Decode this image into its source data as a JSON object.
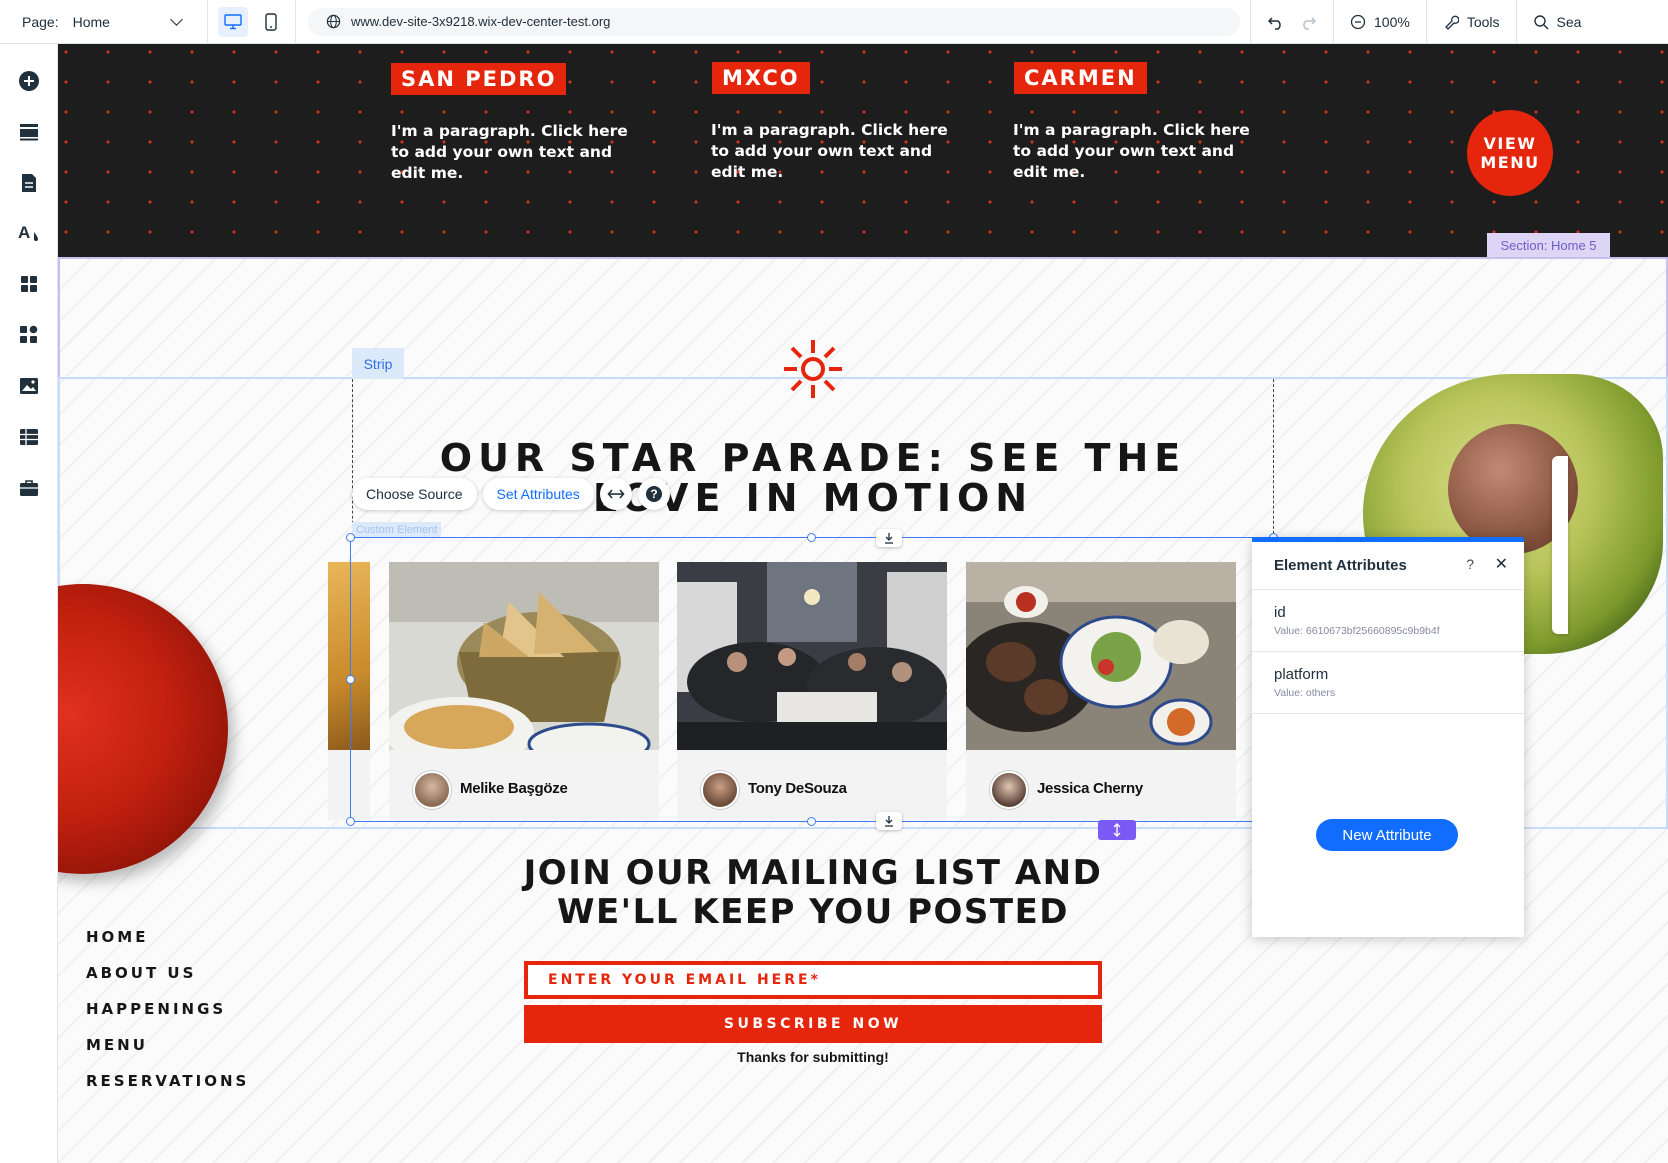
{
  "topbar": {
    "page_label": "Page:",
    "page_value": "Home",
    "url": "www.dev-site-3x9218.wix-dev-center-test.org",
    "zoom": "100%",
    "tools_label": "Tools",
    "search_label": "Sea"
  },
  "hero": {
    "locations": [
      {
        "name": "SAN PEDRO",
        "text": "I'm a paragraph. Click here to add your own text and edit me."
      },
      {
        "name": "MXCO",
        "text": "I'm a paragraph. Click here to add your own text and edit me."
      },
      {
        "name": "CARMEN",
        "text": "I'm a paragraph. Click here to add your own text and edit me."
      }
    ],
    "view_menu": "VIEW MENU",
    "section_label": "Section: Home 5"
  },
  "editor": {
    "strip_label": "Strip",
    "custom_element_label": "Custom Element",
    "choose_source": "Choose Source",
    "set_attributes": "Set Attributes"
  },
  "reviews": {
    "headline": "OUR STAR PARADE: SEE THE LOVE IN MOTION",
    "cards": [
      {
        "name": "Melike Başgöze"
      },
      {
        "name": "Tony DeSouza"
      },
      {
        "name": "Jessica Cherny"
      }
    ]
  },
  "mailing": {
    "heading": "JOIN OUR MAILING LIST AND WE'LL KEEP YOU POSTED",
    "email_placeholder": "ENTER YOUR EMAIL HERE*",
    "subscribe": "SUBSCRIBE NOW",
    "thanks": "Thanks for submitting!"
  },
  "footer_nav": [
    "HOME",
    "ABOUT US",
    "HAPPENINGS",
    "MENU",
    "RESERVATIONS"
  ],
  "attributes_panel": {
    "title": "Element Attributes",
    "help": "?",
    "attributes": [
      {
        "name": "id",
        "value": "Value: 6610673bf25660895c9b9b4f"
      },
      {
        "name": "platform",
        "value": "Value: others"
      }
    ],
    "new_attribute": "New Attribute"
  },
  "colors": {
    "brand_red": "#e6260c",
    "editor_blue": "#116dff",
    "section_purple": "#dcd5f5",
    "stretch_purple": "#7a5af5"
  }
}
